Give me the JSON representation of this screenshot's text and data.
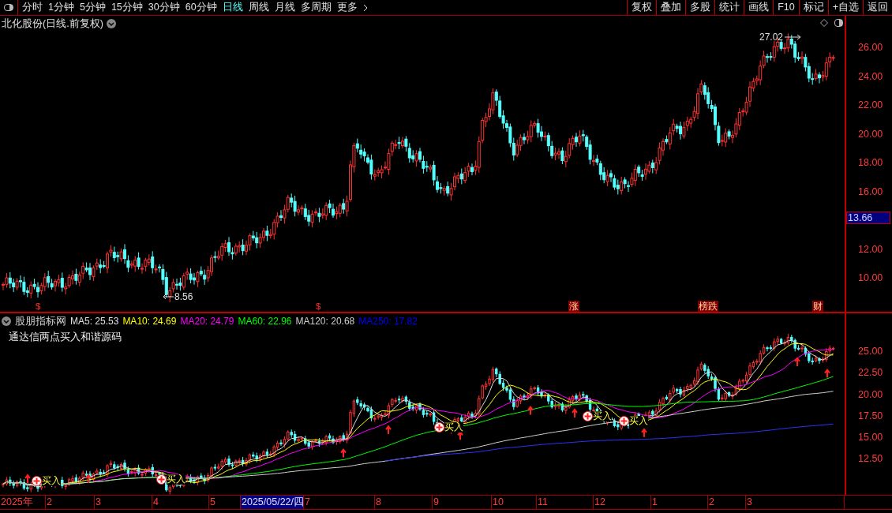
{
  "toolbar": {
    "periods": [
      {
        "label": "分时",
        "selected": false
      },
      {
        "label": "1分钟",
        "selected": false
      },
      {
        "label": "5分钟",
        "selected": false
      },
      {
        "label": "15分钟",
        "selected": false
      },
      {
        "label": "30分钟",
        "selected": false
      },
      {
        "label": "60分钟",
        "selected": false
      },
      {
        "label": "日线",
        "selected": true
      },
      {
        "label": "周线",
        "selected": false
      },
      {
        "label": "月线",
        "selected": false
      },
      {
        "label": "多周期",
        "selected": false
      },
      {
        "label": "更多",
        "selected": false
      }
    ],
    "buttons": [
      "复权",
      "叠加",
      "多股",
      "统计",
      "画线",
      "F10",
      "标记",
      "+自选",
      "返回"
    ]
  },
  "main_chart": {
    "title": "北化股份(日线.前复权)",
    "high_label": "27.02",
    "low_label": "8.56",
    "events": [
      {
        "label": "$",
        "kind": "dollar"
      },
      {
        "label": "$",
        "kind": "dollar"
      },
      {
        "label": "涨",
        "kind": "box"
      },
      {
        "label": "榜跌",
        "kind": "box"
      },
      {
        "label": "财",
        "kind": "box"
      }
    ],
    "price_ticks": [
      "26.00",
      "24.00",
      "22.00",
      "20.00",
      "18.00",
      "16.00",
      "12.00",
      "10.00"
    ],
    "current_price": "13.66"
  },
  "indicator": {
    "name": "股朋指标网",
    "subtitle": "通达信两点买入和谐源码",
    "ma_legend": [
      {
        "label": "MA5: 25.53",
        "color": "#e0e0e0"
      },
      {
        "label": "MA10: 24.69",
        "color": "#ffff00"
      },
      {
        "label": "MA20: 24.79",
        "color": "#ff00ff"
      },
      {
        "label": "MA60: 22.96",
        "color": "#00ff00"
      },
      {
        "label": "MA120: 20.68",
        "color": "#d0d0d0"
      },
      {
        "label": "MA250: 17.82",
        "color": "#0000ff"
      }
    ],
    "buy_labels": [
      "买入",
      "买入",
      "买入",
      "买入",
      "买入"
    ],
    "ticks": [
      "25.00",
      "22.50",
      "20.00",
      "17.50",
      "15.00",
      "12.50"
    ]
  },
  "date_axis": [
    {
      "label": "2025年",
      "selected": false
    },
    {
      "label": "2",
      "selected": false
    },
    {
      "label": "3",
      "selected": false
    },
    {
      "label": "4",
      "selected": false
    },
    {
      "label": "5",
      "selected": false
    },
    {
      "label": "2025/05/22/四",
      "selected": true
    },
    {
      "label": "7",
      "selected": false
    },
    {
      "label": "8",
      "selected": false
    },
    {
      "label": "9",
      "selected": false
    },
    {
      "label": "10",
      "selected": false
    },
    {
      "label": "11",
      "selected": false
    },
    {
      "label": "12",
      "selected": false
    },
    {
      "label": "1",
      "selected": false
    },
    {
      "label": "2",
      "selected": false
    },
    {
      "label": "3",
      "selected": false
    }
  ]
}
